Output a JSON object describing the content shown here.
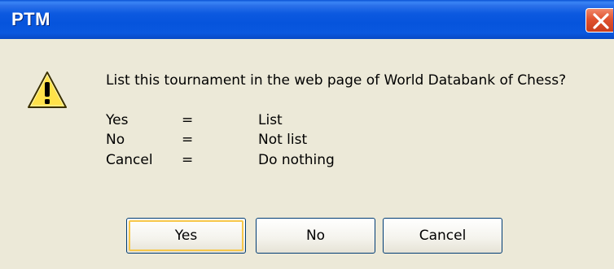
{
  "window": {
    "title": "PTM",
    "close_icon": "close-icon"
  },
  "message": {
    "icon": "warning-icon",
    "question": "List this tournament in the web page of World Databank of Chess?",
    "options": [
      {
        "key": "Yes",
        "sep": "=",
        "meaning": "List"
      },
      {
        "key": "No",
        "sep": "=",
        "meaning": "Not list"
      },
      {
        "key": "Cancel",
        "sep": "=",
        "meaning": "Do nothing"
      }
    ]
  },
  "buttons": {
    "yes": "Yes",
    "no": "No",
    "cancel": "Cancel"
  },
  "colors": {
    "titlebar": "#0654dc",
    "dialog_bg": "#ece9d8",
    "close_button": "#e0522f",
    "focus_ring": "#f7c74a",
    "warning_fill": "#ffe24a"
  }
}
